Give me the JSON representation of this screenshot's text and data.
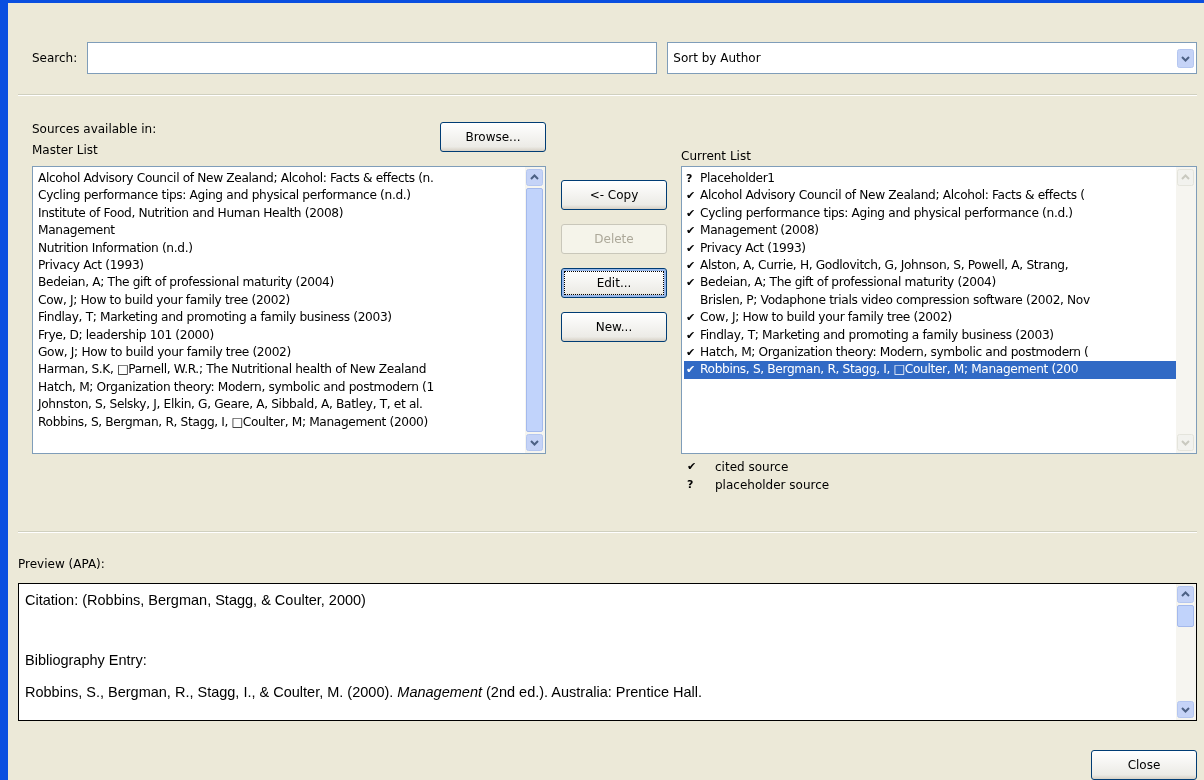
{
  "search": {
    "label": "Search:"
  },
  "sort": {
    "value": "Sort by Author"
  },
  "sources_label": "Sources available in:",
  "browse_button": "Browse...",
  "master_list": {
    "label": "Master List",
    "items": [
      {
        "text": "Alcohol Advisory Council of New Zealand; Alcohol: Facts & effects (n."
      },
      {
        "text": "Cycling performance tips: Aging and physical performance (n.d.)"
      },
      {
        "text": "Institute of Food, Nutrition and Human Health (2008)"
      },
      {
        "text": "Management"
      },
      {
        "text": "Nutrition Information (n.d.)"
      },
      {
        "text": "Privacy Act  (1993)"
      },
      {
        "text": "Bedeian, A; The gift of professional maturity (2004)"
      },
      {
        "text": "Cow, J; How to build your family tree (2002)"
      },
      {
        "text": "Findlay, T; Marketing and promoting a family business (2003)"
      },
      {
        "text": "Frye, D; leadership 101 (2000)"
      },
      {
        "text": "Gow, J; How to build your family tree (2002)"
      },
      {
        "text": "Harman, S.K, □Parnell, W.R.; The Nutritional health of New Zealand"
      },
      {
        "text": "Hatch, M; Organization theory: Modern, symbolic and postmodern (1"
      },
      {
        "text": "Johnston, S, Selsky, J, Elkin, G, Geare, A, Sibbald, A, Batley, T, et al."
      },
      {
        "text": "Robbins, S, Bergman, R, Stagg, I, □Coulter, M; Management (2000)"
      }
    ]
  },
  "actions": [
    {
      "label": "<- Copy",
      "disabled": false,
      "focused": false
    },
    {
      "label": "Delete",
      "disabled": true,
      "focused": false
    },
    {
      "label": "Edit...",
      "disabled": false,
      "focused": true
    },
    {
      "label": "New...",
      "disabled": false,
      "focused": false
    }
  ],
  "current_list": {
    "label": "Current List",
    "items": [
      {
        "mark": "?",
        "text": "Placeholder1",
        "selected": false
      },
      {
        "mark": "✔",
        "text": "Alcohol Advisory Council of New Zealand; Alcohol: Facts & effects (",
        "selected": false
      },
      {
        "mark": "✔",
        "text": "Cycling performance tips: Aging and physical performance (n.d.)",
        "selected": false
      },
      {
        "mark": "✔",
        "text": "Management (2008)",
        "selected": false
      },
      {
        "mark": "✔",
        "text": "Privacy Act  (1993)",
        "selected": false
      },
      {
        "mark": "✔",
        "text": "Alston, A, Currie, H, Godlovitch, G, Johnson, S, Powell, A, Strang,",
        "selected": false
      },
      {
        "mark": "✔",
        "text": "Bedeian, A; The gift of professional maturity (2004)",
        "selected": false
      },
      {
        "text": "Brislen, P; Vodaphone trials video compression software (2002, Nov",
        "selected": false
      },
      {
        "mark": "✔",
        "text": "Cow, J; How to build your family tree (2002)",
        "selected": false
      },
      {
        "mark": "✔",
        "text": "Findlay, T; Marketing and promoting a family business (2003)",
        "selected": false
      },
      {
        "mark": "✔",
        "text": "Hatch, M; Organization theory: Modern, symbolic and postmodern (",
        "selected": false
      },
      {
        "mark": "✔",
        "text": "Robbins, S, Bergman, R, Stagg, I, □Coulter, M; Management (200",
        "selected": true
      }
    ]
  },
  "legend": [
    {
      "mark": "✔",
      "label": "cited source"
    },
    {
      "mark": "?",
      "label": "placeholder source"
    }
  ],
  "preview": {
    "label": "Preview (APA):",
    "lines": [
      "Citation:  (Robbins, Bergman, Stagg, & Coulter, 2000)",
      "Bibliography Entry:",
      "Robbins, S., Bergman, R., Stagg, I., & Coulter, M. (2000).  *Management* (2nd ed.). Australia: Prentice Hall."
    ]
  },
  "close_button": "Close"
}
